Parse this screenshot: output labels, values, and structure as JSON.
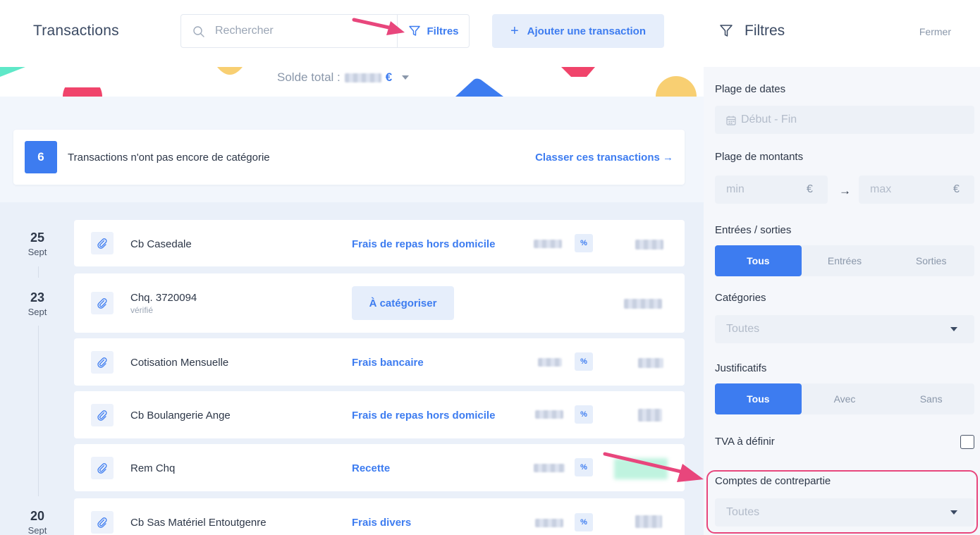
{
  "header": {
    "title": "Transactions",
    "search_placeholder": "Rechercher",
    "filters_label": "Filtres",
    "add_label": "Ajouter une transaction"
  },
  "balance": {
    "label": "Solde total :",
    "currency": "€"
  },
  "notice": {
    "count": "6",
    "text": "Transactions n'ont pas encore de catégorie",
    "link": "Classer ces transactions →"
  },
  "dates": [
    {
      "day": "25",
      "month": "Sept"
    },
    {
      "day": "23",
      "month": "Sept"
    },
    {
      "day": "20",
      "month": "Sept"
    }
  ],
  "transactions": [
    {
      "name": "Cb Casedale",
      "sub": "",
      "category": "Frais de repas hors domicile",
      "uncategorized": false,
      "vat_pct": "%"
    },
    {
      "name": "Chq. 3720094",
      "sub": "vérifié",
      "category": "À catégoriser",
      "uncategorized": true,
      "vat_pct": ""
    },
    {
      "name": "Cotisation Mensuelle",
      "sub": "",
      "category": "Frais bancaire",
      "uncategorized": false,
      "vat_pct": "%"
    },
    {
      "name": "Cb Boulangerie Ange",
      "sub": "",
      "category": "Frais de repas hors domicile",
      "uncategorized": false,
      "vat_pct": "%"
    },
    {
      "name": "Rem Chq",
      "sub": "",
      "category": "Recette",
      "uncategorized": false,
      "vat_pct": "%"
    },
    {
      "name": "Cb Sas Matériel Entoutgenre",
      "sub": "",
      "category": "Frais divers",
      "uncategorized": false,
      "vat_pct": "%"
    }
  ],
  "panel": {
    "title": "Filtres",
    "close_label": "Fermer",
    "date_range": {
      "label": "Plage de dates",
      "placeholder": "Début - Fin"
    },
    "amount_range": {
      "label": "Plage de montants",
      "min_placeholder": "min",
      "max_placeholder": "max",
      "currency": "€",
      "arrow": "→"
    },
    "flows": {
      "label": "Entrées / sorties",
      "options": [
        "Tous",
        "Entrées",
        "Sorties"
      ],
      "selected": "Tous"
    },
    "categories": {
      "label": "Catégories",
      "value": "Toutes"
    },
    "receipts": {
      "label": "Justificatifs",
      "options": [
        "Tous",
        "Avec",
        "Sans"
      ],
      "selected": "Tous"
    },
    "vat": {
      "label": "TVA à définir",
      "checked": false
    },
    "counterpart_accounts": {
      "label": "Comptes de contrepartie",
      "value": "Toutes"
    }
  },
  "colors": {
    "accent": "#3d7cf0",
    "annotation": "#e8467c",
    "positive_amount": "#5fe0b0"
  }
}
